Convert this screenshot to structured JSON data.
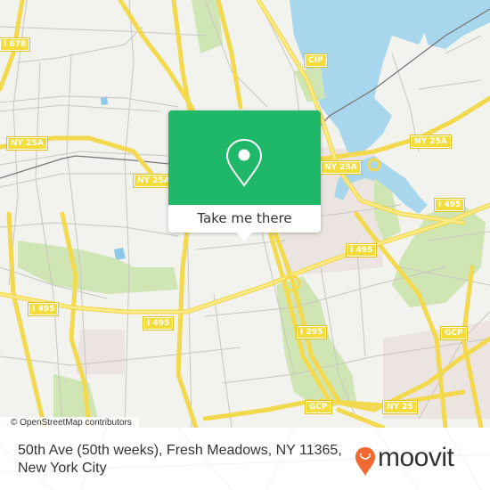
{
  "map": {
    "attribution": "© OpenStreetMap contributors",
    "road_labels": [
      {
        "id": "i678",
        "text": "I 678"
      },
      {
        "id": "cip",
        "text": "CIP"
      },
      {
        "id": "ny25a-west",
        "text": "NY 25A"
      },
      {
        "id": "ny25a-center",
        "text": "NY 25A"
      },
      {
        "id": "ny25a-mid",
        "text": "NY 25A"
      },
      {
        "id": "ny25a-east",
        "text": "NY 25A"
      },
      {
        "id": "i495-east",
        "text": "I 495"
      },
      {
        "id": "i495-center",
        "text": "I 495"
      },
      {
        "id": "i495-west",
        "text": "I 495"
      },
      {
        "id": "i495-mid",
        "text": "I 495"
      },
      {
        "id": "i295",
        "text": "I 295"
      },
      {
        "id": "gcp-east",
        "text": "GCP"
      },
      {
        "id": "gcp-south",
        "text": "GCP"
      },
      {
        "id": "ny25",
        "text": "NY 25"
      }
    ],
    "colors": {
      "land": "#f2f2ee",
      "water": "#a8d6ec",
      "park": "#cfe5b4",
      "highway": "#f7e26b",
      "road": "#c9c6c0",
      "rail": "#777777",
      "urban": "#e8e0dc"
    }
  },
  "popup": {
    "icon": "map-pin-icon",
    "button_label": "Take me there",
    "accent": "#1fb868"
  },
  "footer": {
    "address_line1": "50th Ave (50th weeks), Fresh Meadows, NY 11365,",
    "address_line2": "New York City",
    "brand": "moovit",
    "brand_color": "#f26a31"
  }
}
